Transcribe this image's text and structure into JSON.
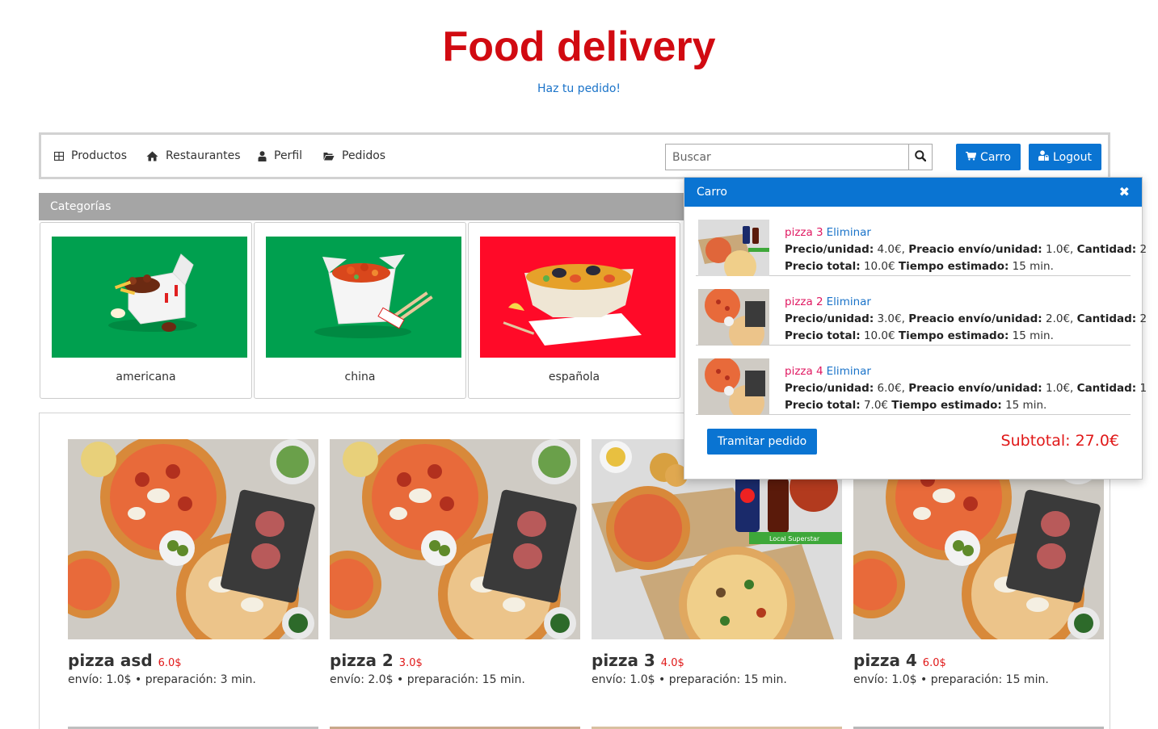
{
  "header": {
    "title": "Food delivery",
    "subtitle": "Haz tu pedido!"
  },
  "nav": {
    "items": [
      {
        "label": "Productos",
        "icon": "grid-icon"
      },
      {
        "label": "Restaurantes",
        "icon": "home-icon"
      },
      {
        "label": "Perfil",
        "icon": "user-icon"
      },
      {
        "label": "Pedidos",
        "icon": "folder-open-icon"
      }
    ],
    "search_placeholder": "Buscar",
    "cart_label": "Carro",
    "logout_label": "Logout"
  },
  "categories": {
    "title": "Categorías",
    "items": [
      {
        "label": "americana",
        "bg": "#00a04f"
      },
      {
        "label": "china",
        "bg": "#00a04f"
      },
      {
        "label": "española",
        "bg": "#ff0a28"
      }
    ]
  },
  "products": [
    {
      "name": "pizza asd",
      "price": "6.0$",
      "meta": "envío: 1.0$ • preparación: 3 min."
    },
    {
      "name": "pizza 2",
      "price": "3.0$",
      "meta": "envío: 2.0$ • preparación: 15 min."
    },
    {
      "name": "pizza 3",
      "price": "4.0$",
      "meta": "envío: 1.0$ • preparación: 15 min.",
      "badge": "Local Superstar"
    },
    {
      "name": "pizza 4",
      "price": "6.0$",
      "meta": "envío: 1.0$ • preparación: 15 min."
    }
  ],
  "cart": {
    "title": "Carro",
    "remove_label": "Eliminar",
    "lbl_unit": "Precio/unidad:",
    "lbl_ship": "Preacio envío/unidad:",
    "lbl_qty": "Cantidad:",
    "lbl_total": "Precio total:",
    "lbl_time": "Tiempo estimado:",
    "items": [
      {
        "name": "pizza 3",
        "unit": "4.0€,",
        "ship": "1.0€,",
        "qty": "2",
        "total": "10.0€",
        "time": "15 min."
      },
      {
        "name": "pizza 2",
        "unit": "3.0€,",
        "ship": "2.0€,",
        "qty": "2",
        "total": "10.0€",
        "time": "15 min."
      },
      {
        "name": "pizza 4",
        "unit": "6.0€,",
        "ship": "1.0€,",
        "qty": "1",
        "total": "7.0€",
        "time": "15 min."
      }
    ],
    "checkout_label": "Tramitar pedido",
    "subtotal": "Subtotal: 27.0€"
  },
  "colors": {
    "brand_red": "#d10a11",
    "primary_blue": "#0a74d2",
    "price_red": "#e01818",
    "item_pink": "#e01a62"
  }
}
